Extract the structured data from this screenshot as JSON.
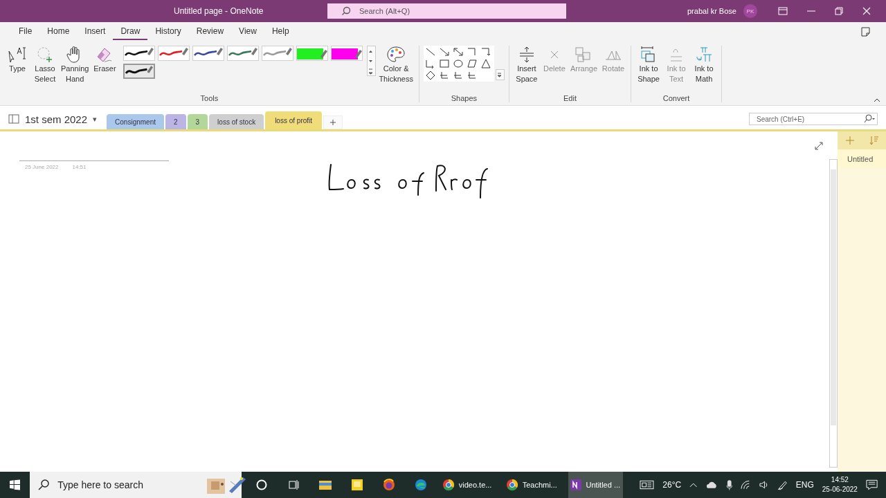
{
  "window": {
    "title": "Untitled page  -  OneNote",
    "search_placeholder": "Search (Alt+Q)",
    "user": "prabal kr Bose",
    "user_initials": "PK"
  },
  "ribbon_tabs": [
    {
      "label": "File",
      "selected": false
    },
    {
      "label": "Home",
      "selected": false
    },
    {
      "label": "Insert",
      "selected": false
    },
    {
      "label": "Draw",
      "selected": true
    },
    {
      "label": "History",
      "selected": false
    },
    {
      "label": "Review",
      "selected": false
    },
    {
      "label": "View",
      "selected": false
    },
    {
      "label": "Help",
      "selected": false
    }
  ],
  "tools": {
    "label": "Tools",
    "buttons": [
      {
        "kind": "type",
        "label": "Type"
      },
      {
        "kind": "lasso",
        "label": "Lasso\nSelect"
      },
      {
        "kind": "hand",
        "label": "Panning\nHand"
      },
      {
        "kind": "eraser",
        "label": "Eraser"
      }
    ],
    "pens": [
      {
        "kind": "pen",
        "color": "#111111",
        "selected": false
      },
      {
        "kind": "pen",
        "color": "#e02020",
        "selected": false
      },
      {
        "kind": "pen",
        "color": "#3a4a9a",
        "selected": false
      },
      {
        "kind": "pen",
        "color": "#3a7a5a",
        "selected": false
      },
      {
        "kind": "pen",
        "color": "#9a9a9a",
        "selected": false
      },
      {
        "kind": "highlighter",
        "color": "#22ee22",
        "selected": false
      },
      {
        "kind": "highlighter",
        "color": "#ff00ee",
        "selected": false
      },
      {
        "kind": "pen",
        "color": "#111111",
        "selected": true
      }
    ],
    "color_thickness": "Color &\nThickness"
  },
  "shapes": {
    "label": "Shapes"
  },
  "edit": {
    "label": "Edit",
    "buttons": [
      {
        "kind": "insert-space",
        "label": "Insert\nSpace",
        "disabled": false
      },
      {
        "kind": "delete",
        "label": "Delete",
        "disabled": true
      },
      {
        "kind": "arrange",
        "label": "Arrange",
        "disabled": true
      },
      {
        "kind": "rotate",
        "label": "Rotate",
        "disabled": true
      }
    ]
  },
  "convert": {
    "label": "Convert",
    "buttons": [
      {
        "kind": "shape",
        "label": "Ink to\nShape",
        "disabled": false
      },
      {
        "kind": "text",
        "label": "Ink to\nText",
        "disabled": true
      },
      {
        "kind": "math",
        "label": "Ink to\nMath",
        "disabled": false
      }
    ]
  },
  "notebook": {
    "name": "1st sem 2022",
    "caret": "▾",
    "sections": [
      {
        "label": "Consignment",
        "color": "#a9c8ec",
        "selected": false
      },
      {
        "label": "2",
        "color": "#bdb4e6",
        "selected": false
      },
      {
        "label": "3",
        "color": "#b3d69a",
        "selected": false
      },
      {
        "label": "loss of stock",
        "color": "#cfcfcf",
        "selected": false
      },
      {
        "label": "loss of profit",
        "color": "#f1dc7a",
        "selected": true
      }
    ],
    "search_placeholder": "Search (Ctrl+E)"
  },
  "page": {
    "date": "25 June 2022",
    "time": "14:51"
  },
  "pages_panel": {
    "pages": [
      {
        "title": "Untitled",
        "selected": true
      }
    ]
  },
  "taskbar": {
    "search_placeholder": "Type here to search",
    "apps": [
      {
        "kind": "cortana",
        "selected": false
      },
      {
        "kind": "taskview",
        "selected": false
      },
      {
        "kind": "explorer",
        "selected": false
      },
      {
        "kind": "notes",
        "selected": false
      },
      {
        "kind": "firefox",
        "selected": false
      },
      {
        "kind": "edge",
        "selected": false
      },
      {
        "kind": "chrome",
        "label": "video.te...",
        "selected": false
      },
      {
        "kind": "chrome",
        "label": "Teachmi...",
        "selected": false
      },
      {
        "kind": "onenote",
        "label": "Untitled ...",
        "selected": true
      }
    ],
    "temperature": "26°C",
    "language": "ENG",
    "time": "14:52",
    "date": "25-06-2022"
  }
}
